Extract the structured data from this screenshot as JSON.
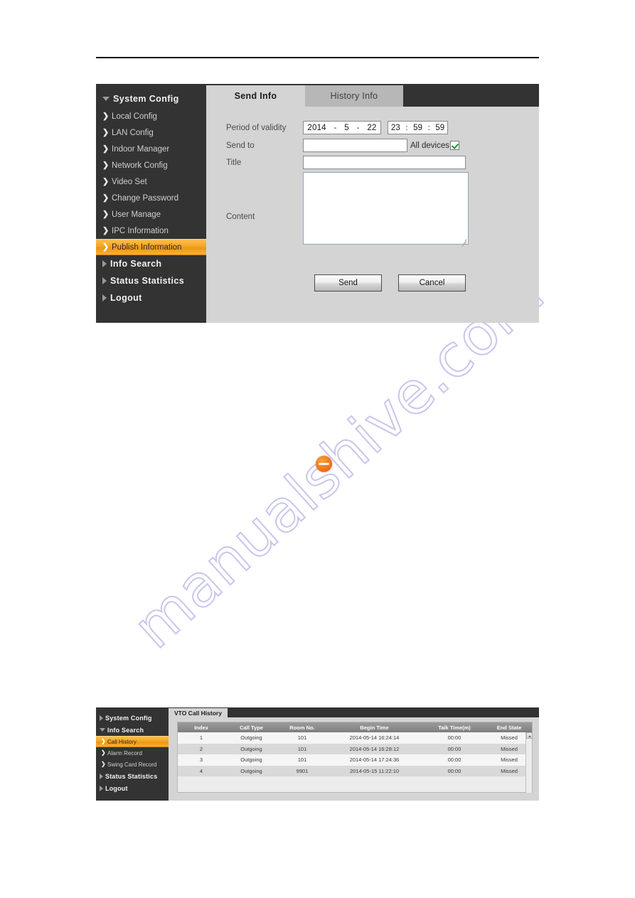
{
  "top_panel": {
    "sidebar": {
      "groups": [
        {
          "label": "System Config",
          "expanded": true,
          "items": [
            {
              "label": "Local Config",
              "active": false
            },
            {
              "label": "LAN Config",
              "active": false
            },
            {
              "label": "Indoor Manager",
              "active": false
            },
            {
              "label": "Network Config",
              "active": false
            },
            {
              "label": "Video Set",
              "active": false
            },
            {
              "label": "Change Password",
              "active": false
            },
            {
              "label": "User Manage",
              "active": false
            },
            {
              "label": "IPC Information",
              "active": false
            },
            {
              "label": "Publish Information",
              "active": true
            }
          ]
        },
        {
          "label": "Info Search",
          "expanded": false,
          "items": []
        },
        {
          "label": "Status Statistics",
          "expanded": false,
          "items": []
        },
        {
          "label": "Logout",
          "expanded": false,
          "items": []
        }
      ]
    },
    "tabs": [
      {
        "label": "Send Info",
        "active": true
      },
      {
        "label": "History Info",
        "active": false
      }
    ],
    "form": {
      "period_label": "Period of validity",
      "date": {
        "year": "2014",
        "dash1": "-",
        "month": "5",
        "dash2": "-",
        "day": "22"
      },
      "time": {
        "hour": "23",
        "colon1": ":",
        "minute": "59",
        "colon2": ":",
        "second": "59"
      },
      "sendto_label": "Send to",
      "sendto_value": "",
      "all_devices_label": "All devices",
      "all_devices_checked": true,
      "title_label": "Title",
      "title_value": "",
      "content_label": "Content",
      "content_value": ""
    },
    "buttons": {
      "send": "Send",
      "cancel": "Cancel"
    }
  },
  "bottom_panel": {
    "sidebar": {
      "groups": [
        {
          "label": "System Config",
          "expanded": false,
          "items": []
        },
        {
          "label": "Info Search",
          "expanded": true,
          "items": [
            {
              "label": "Call History",
              "active": true
            },
            {
              "label": "Alarm Record",
              "active": false
            },
            {
              "label": "Swing Card Record",
              "active": false
            }
          ]
        },
        {
          "label": "Status Statistics",
          "expanded": false,
          "items": []
        },
        {
          "label": "Logout",
          "expanded": false,
          "items": []
        }
      ]
    },
    "tab_label": "VTO Call History",
    "table": {
      "columns": [
        "Index",
        "Call Type",
        "Room No.",
        "Begin Time",
        "Talk Time(m)",
        "End State"
      ],
      "rows": [
        [
          "1",
          "Outgoing",
          "101",
          "2014-05-14 16:24:14",
          "00:00",
          "Missed"
        ],
        [
          "2",
          "Outgoing",
          "101",
          "2014-05-14 16:28:12",
          "00:00",
          "Missed"
        ],
        [
          "3",
          "Outgoing",
          "101",
          "2014-05-14 17:24:36",
          "00:00",
          "Missed"
        ],
        [
          "4",
          "Outgoing",
          "9901",
          "2014-05-15 11:22:10",
          "00:00",
          "Missed"
        ]
      ]
    }
  },
  "watermark": {
    "text": "manualshive.com"
  },
  "colors": {
    "accent_orange": "#f5a623",
    "sidebar_dark": "#333333",
    "panel_gray": "#d4d4d4",
    "check_green": "#1f8f2e"
  }
}
